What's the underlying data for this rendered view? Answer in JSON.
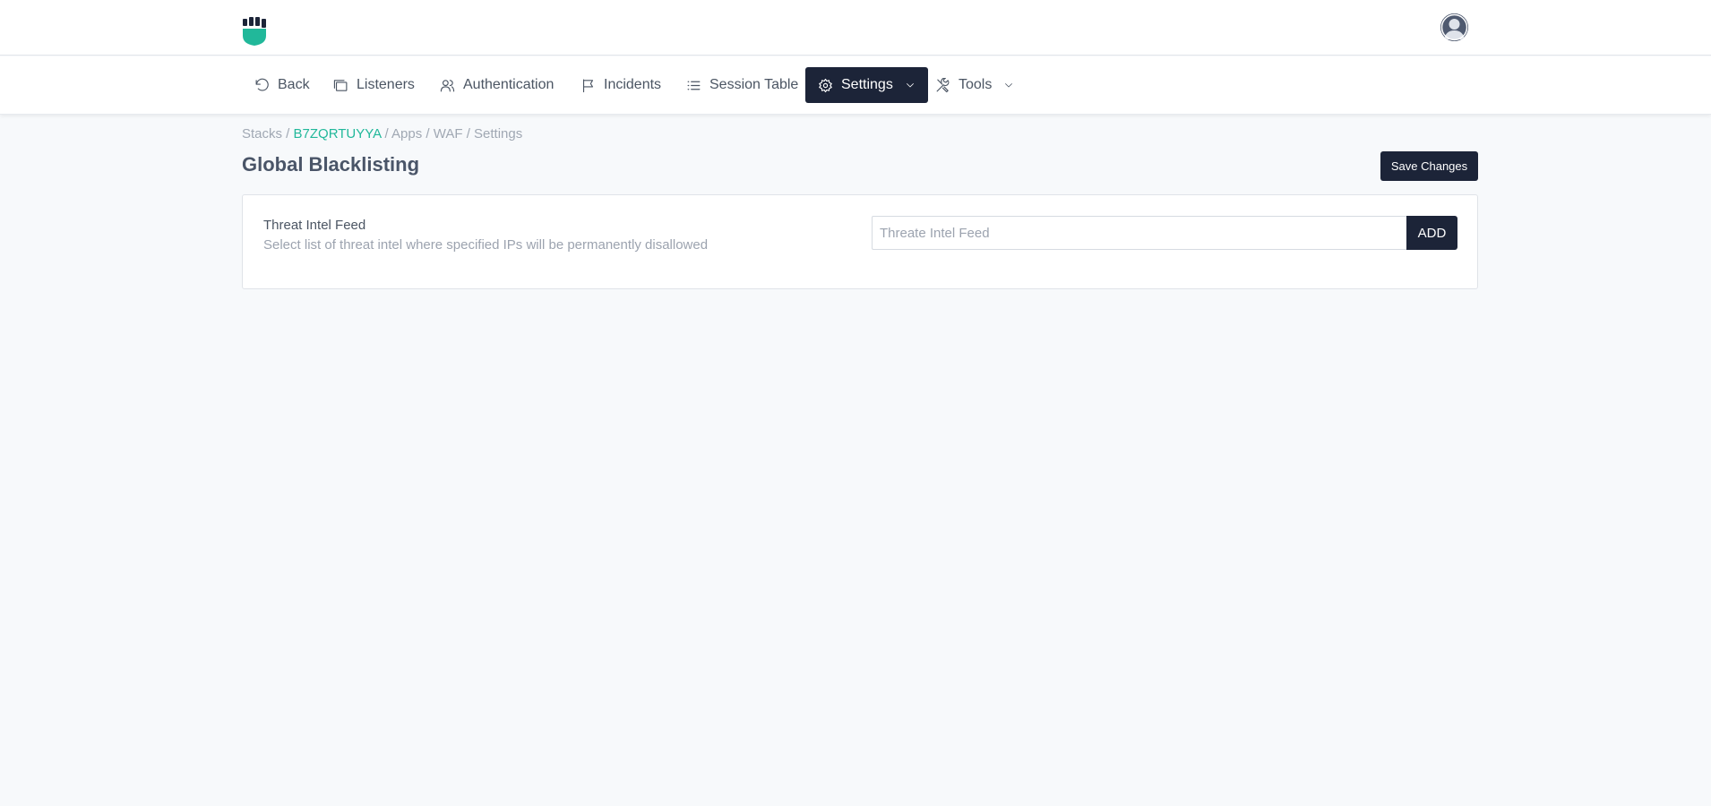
{
  "header": {
    "logo_icon": "shield-fist-logo-icon",
    "avatar_icon": "user-avatar-icon"
  },
  "nav": {
    "items": [
      {
        "label": "Back",
        "icon": "undo-icon"
      },
      {
        "label": "Listeners",
        "icon": "windows-icon"
      },
      {
        "label": "Authentication",
        "icon": "users-icon"
      },
      {
        "label": "Incidents",
        "icon": "flag-icon"
      },
      {
        "label": "Session Table",
        "icon": "list-icon"
      },
      {
        "label": "Settings",
        "icon": "gear-icon",
        "active": true
      },
      {
        "label": "Tools",
        "icon": "tools-icon"
      }
    ]
  },
  "breadcrumb": {
    "stacks": "Stacks",
    "sep1": " / ",
    "stack_id": "B7ZQRTUYYA",
    "sep2": " / ",
    "apps": "Apps",
    "sep3": " / ",
    "waf": "WAF",
    "sep4": " / ",
    "settings": "Settings"
  },
  "page": {
    "title": "Global Blacklisting",
    "save_label": "Save Changes"
  },
  "card": {
    "title": "Threat Intel Feed",
    "description": "Select list of threat intel where specified IPs will be permanently disallowed",
    "input_value": "",
    "input_placeholder": "Threate Intel Feed",
    "add_label": "ADD"
  },
  "colors": {
    "accent": "#21b89a",
    "dark": "#1c2438",
    "background": "#f7f9fb"
  }
}
